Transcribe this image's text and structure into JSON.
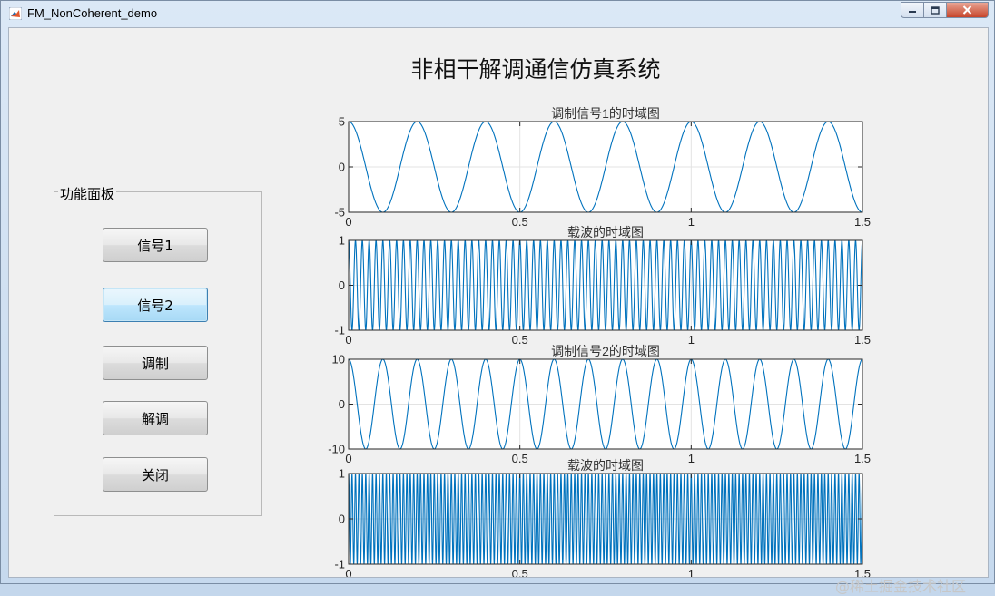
{
  "window": {
    "title": "FM_NonCoherent_demo",
    "controls": [
      "minimize",
      "maximize",
      "close"
    ]
  },
  "header": {
    "title": "非相干解调通信仿真系统"
  },
  "panel": {
    "title": "功能面板",
    "buttons": [
      {
        "label": "信号1",
        "active": false
      },
      {
        "label": "信号2",
        "active": true
      },
      {
        "label": "调制",
        "active": false
      },
      {
        "label": "解调",
        "active": false
      },
      {
        "label": "关闭",
        "active": false
      }
    ]
  },
  "watermark": "@稀土掘金技术社区",
  "colors": {
    "line": "#0072bd",
    "axes": "#262626",
    "grid": "#e3e3e3",
    "accent_button": "#bee6fd"
  },
  "chart_data": [
    {
      "type": "line",
      "title": "调制信号1的时域图",
      "xlim": [
        0,
        1.5
      ],
      "ylim": [
        -5,
        5
      ],
      "x_ticks": [
        "0",
        "0.5",
        "1",
        "1.5"
      ],
      "y_ticks": [
        "5",
        "0",
        "-5"
      ],
      "grid": true,
      "series": [
        {
          "function": "cosine",
          "amplitude": 5,
          "frequency_hz": 5,
          "x_range": [
            0,
            1.5
          ]
        }
      ]
    },
    {
      "type": "line",
      "title": "载波的时域图",
      "xlim": [
        0,
        1.5
      ],
      "ylim": [
        -1,
        1
      ],
      "x_ticks": [
        "0",
        "0.5",
        "1",
        "1.5"
      ],
      "y_ticks": [
        "1",
        "0",
        "-1"
      ],
      "grid": true,
      "series": [
        {
          "function": "cosine",
          "amplitude": 1,
          "frequency_hz": 50,
          "x_range": [
            0,
            1.5
          ]
        }
      ]
    },
    {
      "type": "line",
      "title": "调制信号2的时域图",
      "xlim": [
        0,
        1.5
      ],
      "ylim": [
        -10,
        10
      ],
      "x_ticks": [
        "0",
        "0.5",
        "1",
        "1.5"
      ],
      "y_ticks": [
        "10",
        "0",
        "-10"
      ],
      "grid": true,
      "series": [
        {
          "function": "cosine",
          "amplitude": 10,
          "frequency_hz": 10,
          "x_range": [
            0,
            1.5
          ]
        }
      ]
    },
    {
      "type": "line",
      "title": "载波的时域图",
      "xlim": [
        0,
        1.5
      ],
      "ylim": [
        -1,
        1
      ],
      "x_ticks": [
        "0",
        "0.5",
        "1",
        "1.5"
      ],
      "y_ticks": [
        "1",
        "0",
        "-1"
      ],
      "grid": true,
      "series": [
        {
          "function": "cosine",
          "amplitude": 1,
          "frequency_hz": 100,
          "x_range": [
            0,
            1.5
          ]
        }
      ]
    }
  ]
}
